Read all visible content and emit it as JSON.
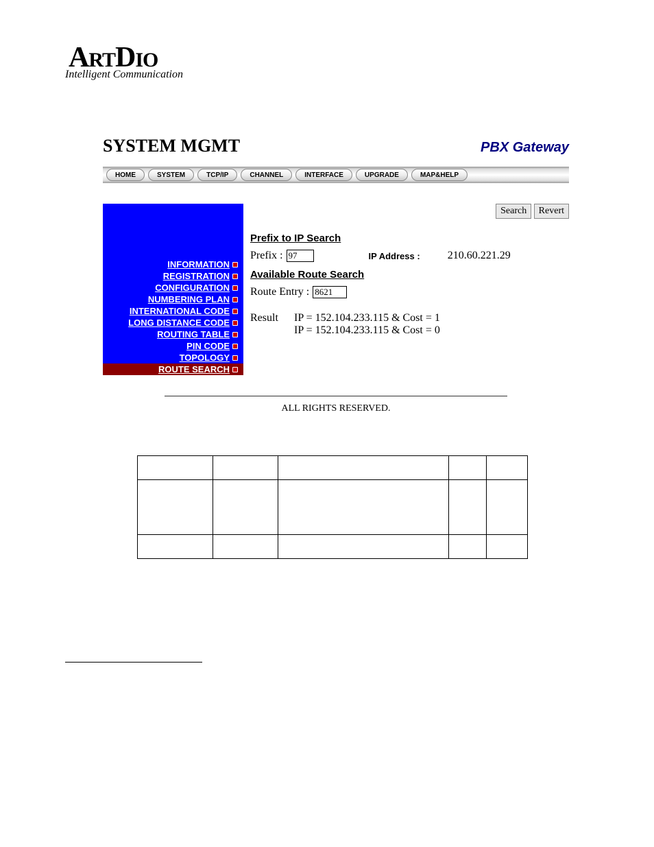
{
  "logo": {
    "main": "ArtDio",
    "sub": "Intelligent Communication"
  },
  "header": {
    "title": "SYSTEM MGMT",
    "product": "PBX Gateway"
  },
  "nav": {
    "items": [
      "HOME",
      "SYSTEM",
      "TCP/IP",
      "CHANNEL",
      "INTERFACE",
      "UPGRADE",
      "MAP&HELP"
    ]
  },
  "sidebar": {
    "items": [
      {
        "label": "INFORMATION",
        "active": false
      },
      {
        "label": "REGISTRATION",
        "active": false
      },
      {
        "label": "CONFIGURATION",
        "active": false
      },
      {
        "label": "NUMBERING PLAN",
        "active": false
      },
      {
        "label": "INTERNATIONAL CODE",
        "active": false
      },
      {
        "label": "LONG DISTANCE CODE",
        "active": false
      },
      {
        "label": "ROUTING TABLE",
        "active": false
      },
      {
        "label": "PIN CODE",
        "active": false
      },
      {
        "label": "TOPOLOGY",
        "active": false
      },
      {
        "label": "ROUTE SEARCH",
        "active": true
      }
    ]
  },
  "actions": {
    "search": "Search",
    "revert": "Revert"
  },
  "prefix_search": {
    "title": "Prefix to IP Search",
    "prefix_label": "Prefix :",
    "prefix_value": "97",
    "ip_label": "IP Address :",
    "ip_value": "210.60.221.29"
  },
  "route_search": {
    "title": "Available Route Search",
    "entry_label": "Route Entry :",
    "entry_value": "8621",
    "result_label": "Result",
    "result_line1": "IP = 152.104.233.115 & Cost = 1",
    "result_line2": "IP = 152.104.233.115 & Cost = 0"
  },
  "footer": {
    "text": "ALL RIGHTS RESERVED."
  }
}
